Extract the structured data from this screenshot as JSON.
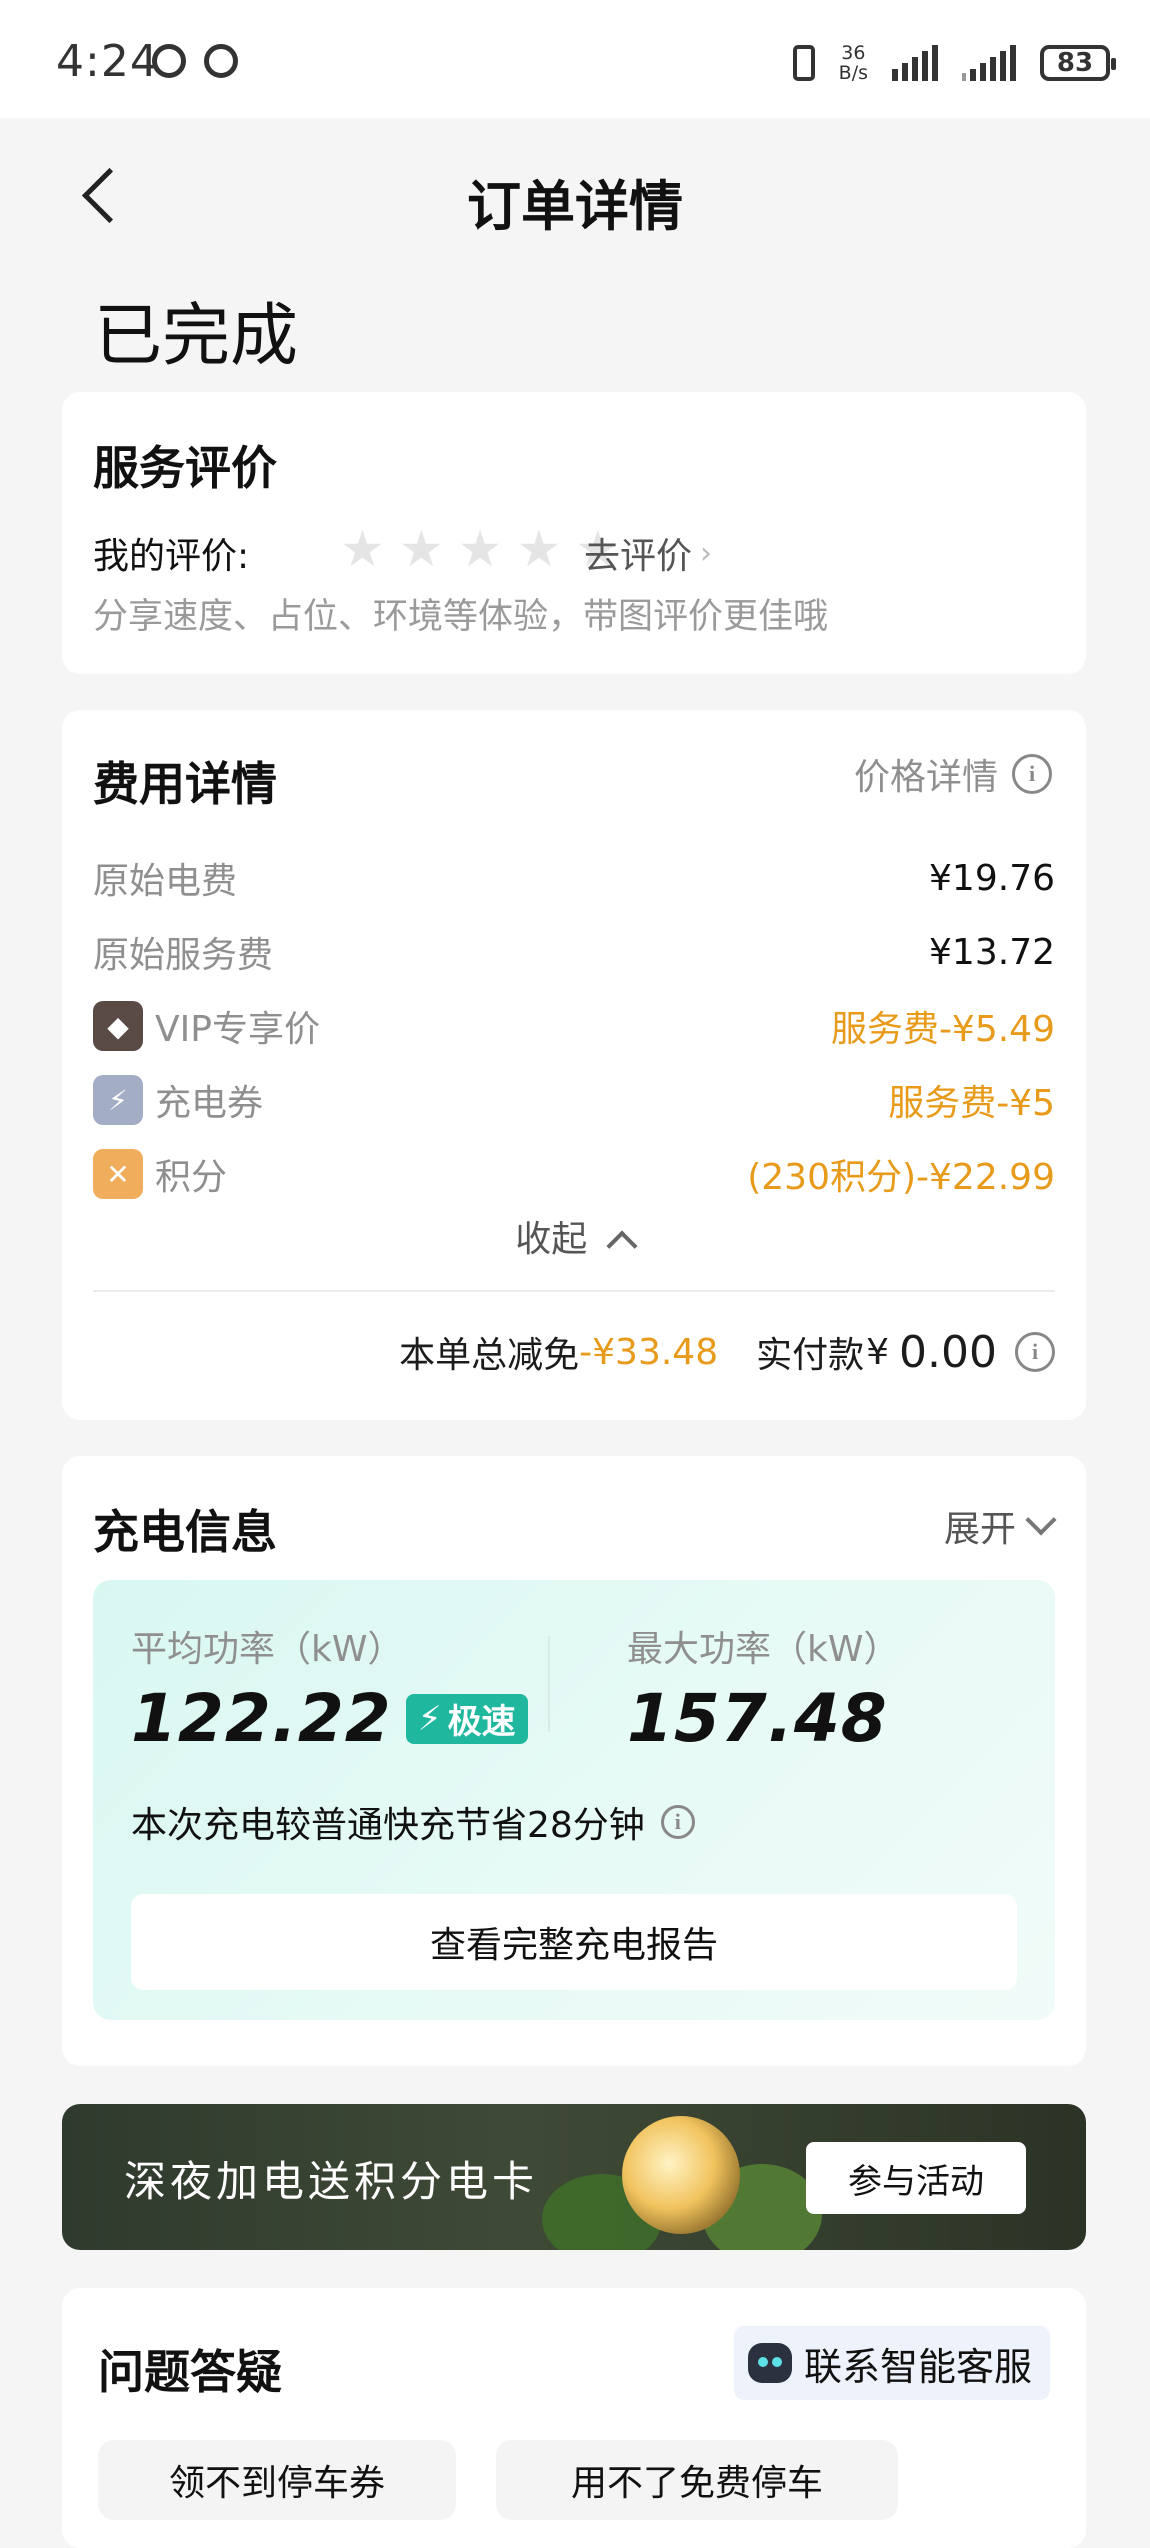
{
  "status_bar": {
    "time": "4:24",
    "net_speed_value": "36",
    "net_speed_unit": "B/s",
    "battery": "83"
  },
  "header": {
    "title": "订单详情",
    "order_status": "已完成"
  },
  "review": {
    "title": "服务评价",
    "my_rating_label": "我的评价:",
    "rating": 0,
    "max_rating": 5,
    "go_review": "去评价",
    "hint": "分享速度、占位、环境等体验，带图评价更佳哦"
  },
  "fees": {
    "title": "费用详情",
    "price_detail_link": "价格详情",
    "rows": [
      {
        "name": "原始电费",
        "value": "¥19.76"
      },
      {
        "name": "原始服务费",
        "value": "¥13.72"
      },
      {
        "name": "VIP专享价",
        "value": "服务费-¥5.49",
        "icon": "vip-diamond-icon",
        "color": "#5a4a46"
      },
      {
        "name": "充电券",
        "value": "服务费-¥5",
        "icon": "coupon-bolt-icon",
        "color": "#a3aec6"
      },
      {
        "name": "积分",
        "value": "(230积分)-¥22.99",
        "icon": "points-icon",
        "color": "#f0ad5c"
      }
    ],
    "collapse": "收起",
    "total_discount_label": "本单总减免",
    "total_discount_value": "-¥33.48",
    "paid_label": "实付款",
    "paid_currency": "¥",
    "paid_value": "0.00",
    "accent": "#e89a1a"
  },
  "charge_info": {
    "title": "充电信息",
    "expand": "展开",
    "avg_power_label": "平均功率（kW）",
    "avg_power_value": "122.22",
    "fast_tag": "极速",
    "max_power_label": "最大功率（kW）",
    "max_power_value": "157.48",
    "saving_text": "本次充电较普通快充节省28分钟",
    "report_button": "查看完整充电报告",
    "accent": "#1fb89f"
  },
  "banner": {
    "text": "深夜加电送积分电卡",
    "button": "参与活动"
  },
  "faq": {
    "title": "问题答疑",
    "service_button": "联系智能客服",
    "chips": [
      "领不到停车券",
      "用不了免费停车"
    ]
  }
}
